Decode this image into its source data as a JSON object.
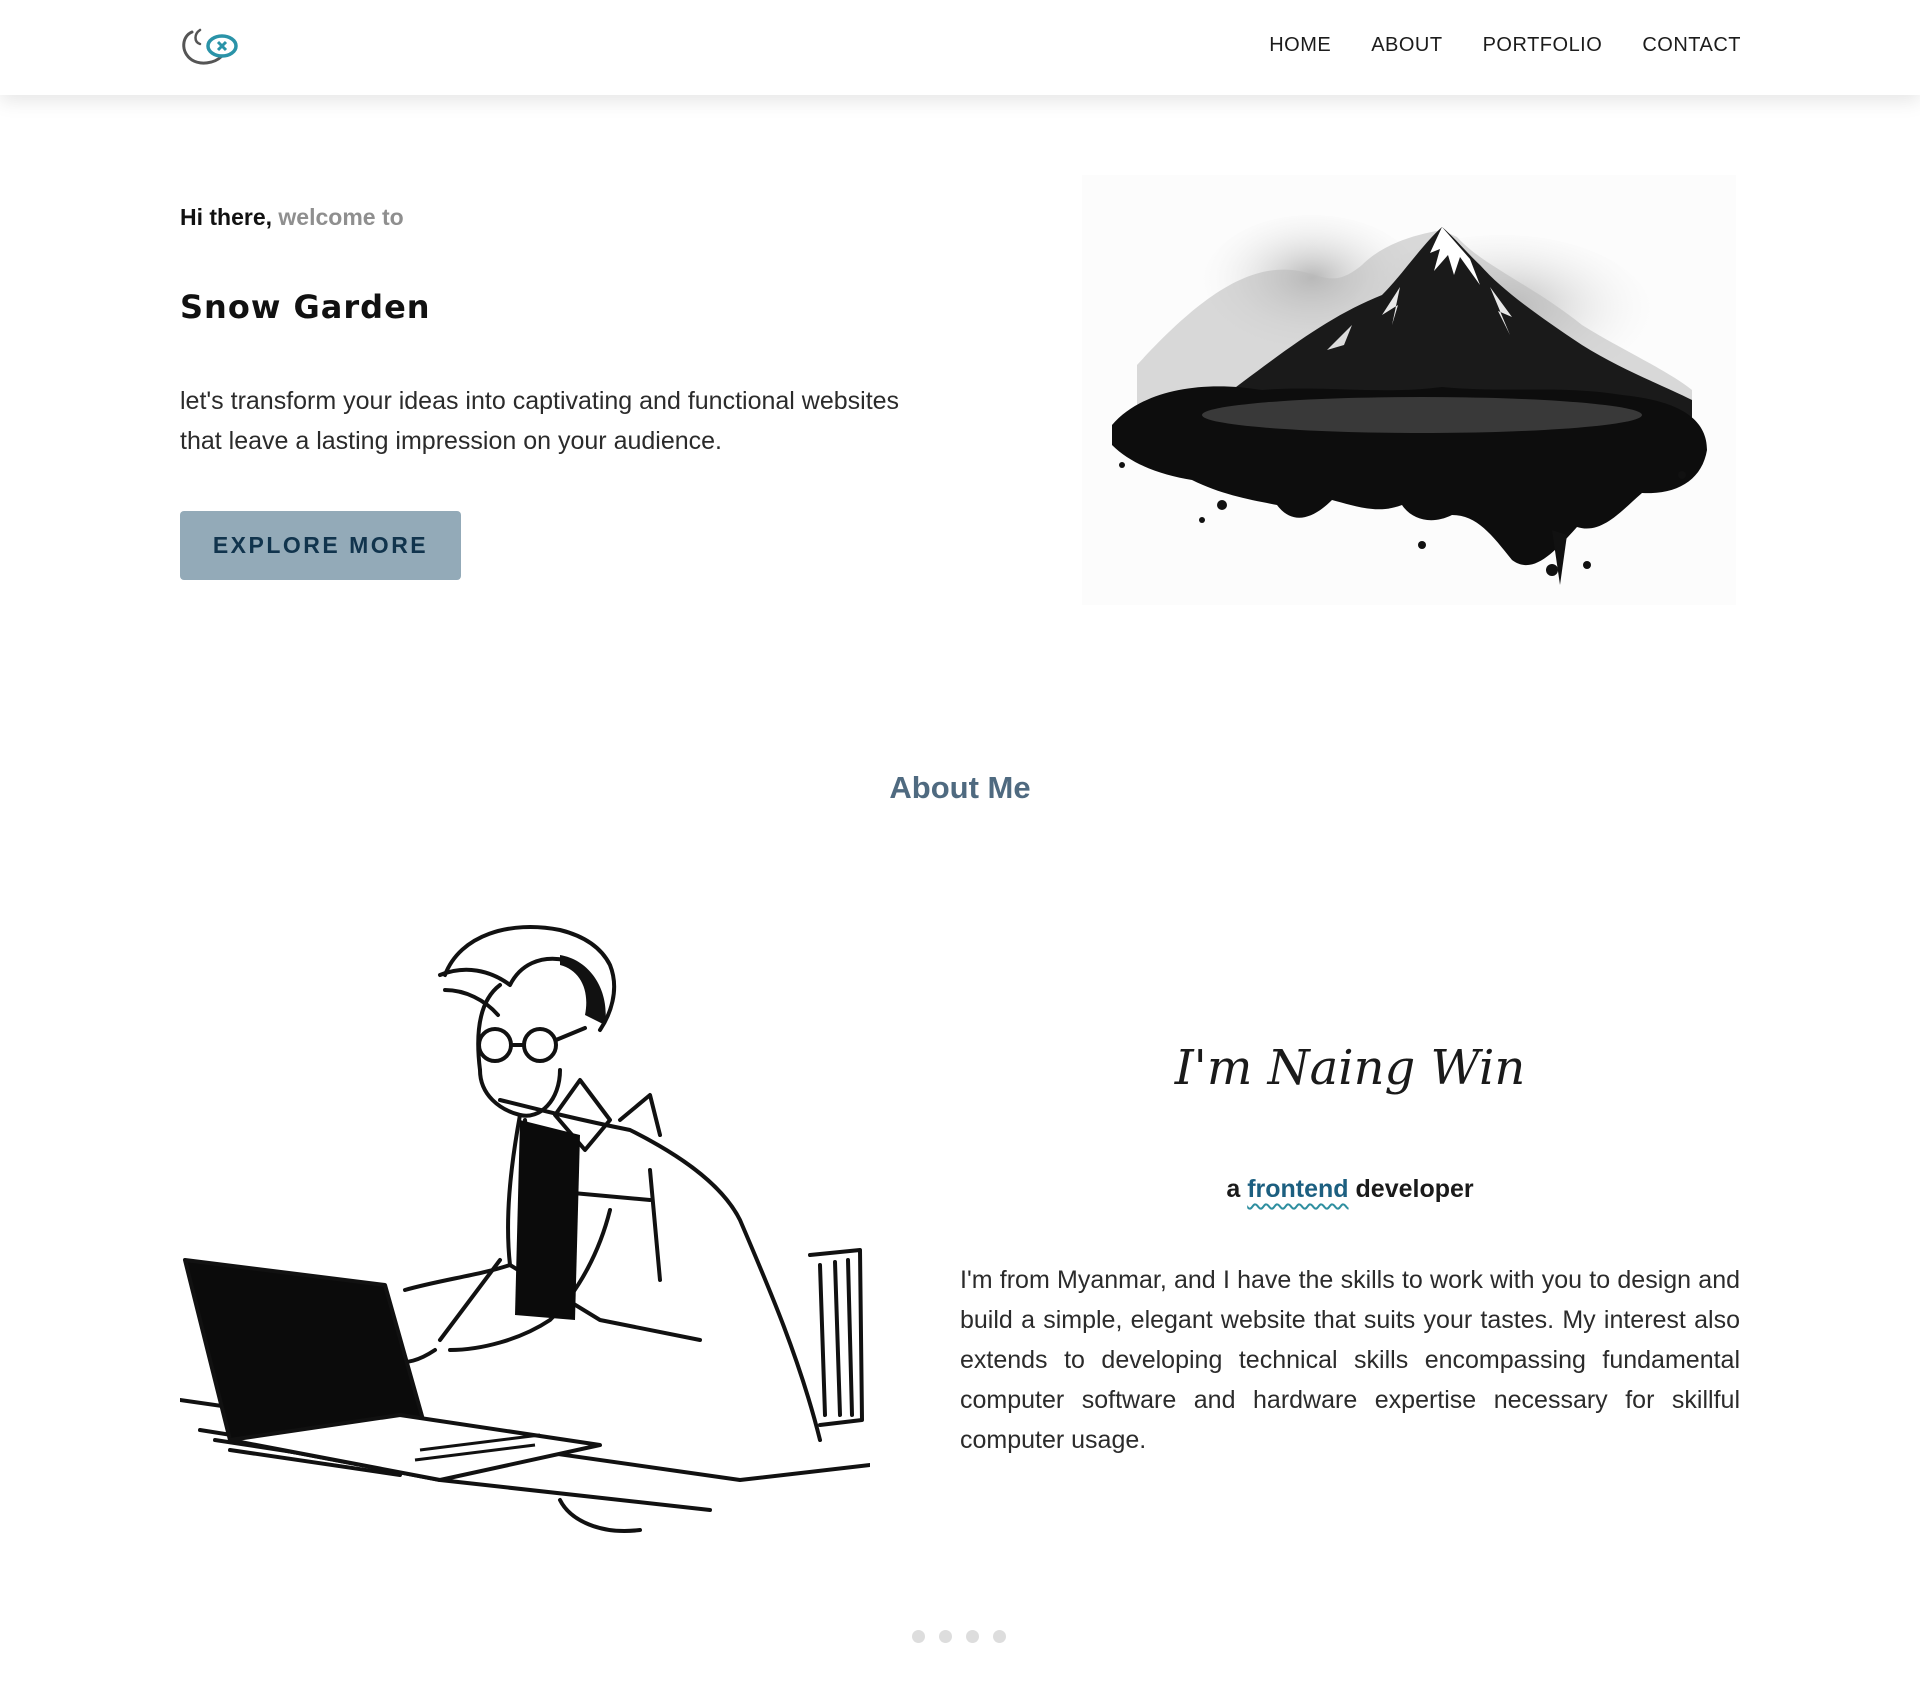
{
  "nav": {
    "logo_alt": "logo",
    "links": [
      "HOME",
      "ABOUT",
      "PORTFOLIO",
      "CONTACT"
    ]
  },
  "hero": {
    "greeting_strong": "Hi there,",
    "greeting_muted": "welcome to",
    "title": "Snow Garden",
    "text": "let's transform your ideas into captivating and functional websites that leave a lasting impression on your audience.",
    "button_label": "EXPLORE MORE"
  },
  "about": {
    "heading": "About Me",
    "name": "I'm Naing Win",
    "role_prefix": "a",
    "role_accent": "frontend",
    "role_suffix": "developer",
    "text": "I'm from Myanmar, and I have the skills to work with you to design and build a simple, elegant website that suits your tastes. My interest also extends to developing technical skills encompassing fundamental computer software and hardware expertise necessary for skillful computer usage."
  },
  "pager": {
    "count": 4
  },
  "colors": {
    "accent": "#4f6a80",
    "button_bg": "#93aab8",
    "button_text": "#11344d",
    "link_accent": "#1c5f80"
  }
}
